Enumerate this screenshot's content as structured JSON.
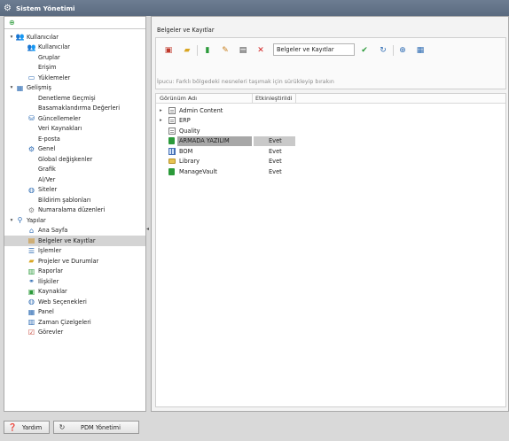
{
  "window": {
    "title": "Sistem Yönetimi"
  },
  "tree": {
    "items": [
      {
        "label": "Kullanıcılar",
        "level": 0,
        "expanded": true,
        "icon": "users-icon"
      },
      {
        "label": "Kullanıcılar",
        "level": 1,
        "icon": "users-icon"
      },
      {
        "label": "Gruplar",
        "level": 2,
        "icon": ""
      },
      {
        "label": "Erişim",
        "level": 2,
        "icon": ""
      },
      {
        "label": "Yüklemeler",
        "level": 1,
        "icon": "monitor-icon"
      },
      {
        "label": "Gelişmiş",
        "level": 0,
        "expanded": true,
        "icon": "grid-icon"
      },
      {
        "label": "Denetleme Geçmişi",
        "level": 2,
        "icon": ""
      },
      {
        "label": "Basamaklandırma Değerleri",
        "level": 2,
        "icon": ""
      },
      {
        "label": "Güncellemeler",
        "level": 1,
        "icon": "database-icon"
      },
      {
        "label": "Veri Kaynakları",
        "level": 2,
        "icon": ""
      },
      {
        "label": "E-posta",
        "level": 2,
        "icon": ""
      },
      {
        "label": "Genel",
        "level": 1,
        "icon": "gear-icon"
      },
      {
        "label": "Global değişkenler",
        "level": 2,
        "icon": ""
      },
      {
        "label": "Grafik",
        "level": 2,
        "icon": ""
      },
      {
        "label": "Al/Ver",
        "level": 2,
        "icon": ""
      },
      {
        "label": "Siteler",
        "level": 1,
        "icon": "globe-icon"
      },
      {
        "label": "Bildirim şablonları",
        "level": 2,
        "icon": ""
      },
      {
        "label": "Numaralama düzenleri",
        "level": 1,
        "icon": "gear-gray-icon"
      },
      {
        "label": "Yapılar",
        "level": 0,
        "expanded": true,
        "icon": "structure-icon"
      },
      {
        "label": "Ana Sayfa",
        "level": 1,
        "icon": "home-icon"
      },
      {
        "label": "Belgeler ve Kayıtlar",
        "level": 1,
        "icon": "document-icon",
        "selected": true
      },
      {
        "label": "İşlemler",
        "level": 1,
        "icon": "list-icon"
      },
      {
        "label": "Projeler ve Durumlar",
        "level": 1,
        "icon": "folder-icon"
      },
      {
        "label": "Raporlar",
        "level": 1,
        "icon": "report-icon"
      },
      {
        "label": "İlişkiler",
        "level": 1,
        "icon": "relations-icon"
      },
      {
        "label": "Kaynaklar",
        "level": 1,
        "icon": "resources-icon"
      },
      {
        "label": "Web Seçenekleri",
        "level": 1,
        "icon": "web-icon"
      },
      {
        "label": "Panel",
        "level": 1,
        "icon": "panel-icon"
      },
      {
        "label": "Zaman Çizelgeleri",
        "level": 1,
        "icon": "timesheet-icon"
      },
      {
        "label": "Görevler",
        "level": 1,
        "icon": "tasks-icon"
      }
    ]
  },
  "right": {
    "title": "Belgeler ve Kayıtlar",
    "search_value": "Belgeler ve Kayıtlar",
    "hint": "İpucu: Farklı bölgedeki nesneleri taşımak için sürükleyip bırakın",
    "columns": {
      "name": "Görünüm Adı",
      "enabled": "Etkinleştirildi"
    },
    "rows": [
      {
        "name": "Admin Content",
        "enabled": "",
        "expandable": true,
        "icon": "document-icon"
      },
      {
        "name": "ERP",
        "enabled": "",
        "expandable": true,
        "icon": "document-icon"
      },
      {
        "name": "Quality",
        "enabled": "",
        "expandable": false,
        "icon": "document-icon"
      },
      {
        "name": "ARMADA YAZILIM",
        "enabled": "Evet",
        "expandable": false,
        "icon": "green-book-icon",
        "selected": true
      },
      {
        "name": "BOM",
        "enabled": "Evet",
        "expandable": false,
        "icon": "table-icon"
      },
      {
        "name": "Library",
        "enabled": "Evet",
        "expandable": false,
        "icon": "folder-icon"
      },
      {
        "name": "ManageVault",
        "enabled": "Evet",
        "expandable": false,
        "icon": "green-book-icon"
      }
    ]
  },
  "bottom": {
    "help_label": "Yardım",
    "pdm_label": "PDM Yönetimi"
  },
  "colors": {
    "titlebar": "#5f6f84",
    "selection": "#a7a7a7",
    "accent_green": "#2b9a3a",
    "delete_red": "#d22020"
  }
}
